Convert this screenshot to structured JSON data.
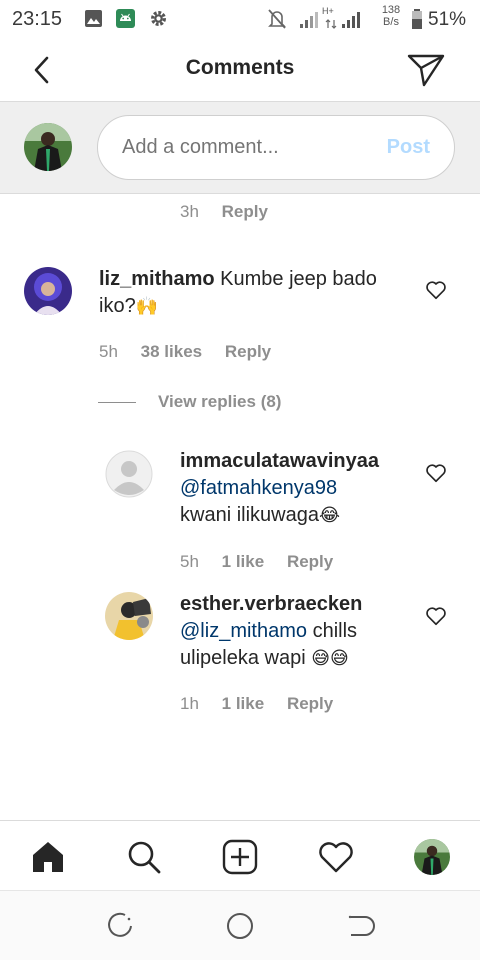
{
  "status_bar": {
    "time": "23:15",
    "network_speed_value": "138",
    "network_speed_unit": "B/s",
    "battery_percent": "51%",
    "network_type": "H+"
  },
  "header": {
    "title": "Comments"
  },
  "compose": {
    "placeholder": "Add a comment...",
    "post_label": "Post"
  },
  "prev_comment_meta": {
    "time": "3h",
    "reply_label": "Reply"
  },
  "comments": [
    {
      "username": "liz_mithamo",
      "text": "Kumbe jeep bado iko?",
      "emoji": "🙌",
      "time": "5h",
      "likes": "38 likes",
      "reply_label": "Reply",
      "view_replies": "View replies (8)"
    }
  ],
  "replies": [
    {
      "username": "immaculatawavinyaa",
      "mention": "@fatmahkenya98",
      "text": "kwani ilikuwaga",
      "emoji": "😂",
      "time": "5h",
      "likes": "1 like",
      "reply_label": "Reply"
    },
    {
      "username": "esther.verbraecken",
      "mention": "@liz_mithamo",
      "text_line1": "chills",
      "text_line2": "ulipeleka wapi",
      "emoji": "😅😅",
      "time": "1h",
      "likes": "1 like",
      "reply_label": "Reply"
    }
  ],
  "colors": {
    "mention": "#00376b",
    "post_disabled": "#b3dbff",
    "meta": "#8e8e8e",
    "text": "#262626"
  },
  "icons": {
    "back": "chevron-left-icon",
    "share": "paper-plane-icon",
    "heart": "heart-outline-icon",
    "home": "home-icon",
    "search": "search-icon",
    "add": "plus-square-icon",
    "activity": "heart-outline-icon"
  }
}
